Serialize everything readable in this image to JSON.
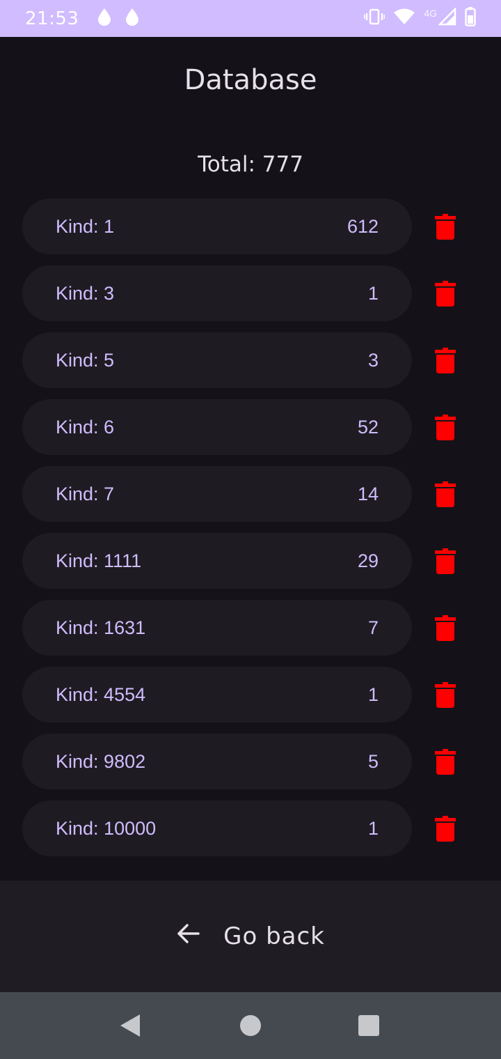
{
  "status_bar": {
    "time": "21:53",
    "network": "4G",
    "icons": [
      "drop-icon",
      "drop-icon",
      "vibrate-icon",
      "wifi-icon",
      "cell-signal-icon",
      "battery-icon"
    ]
  },
  "title": "Database",
  "total": {
    "label": "Total: ",
    "value": "777"
  },
  "kinds": [
    {
      "label": "Kind: ",
      "kind": "1",
      "count": "612"
    },
    {
      "label": "Kind: ",
      "kind": "3",
      "count": "1"
    },
    {
      "label": "Kind: ",
      "kind": "5",
      "count": "3"
    },
    {
      "label": "Kind: ",
      "kind": "6",
      "count": "52"
    },
    {
      "label": "Kind: ",
      "kind": "7",
      "count": "14"
    },
    {
      "label": "Kind: ",
      "kind": "1111",
      "count": "29"
    },
    {
      "label": "Kind: ",
      "kind": "1631",
      "count": "7"
    },
    {
      "label": "Kind: ",
      "kind": "4554",
      "count": "1"
    },
    {
      "label": "Kind: ",
      "kind": "9802",
      "count": "5"
    },
    {
      "label": "Kind: ",
      "kind": "10000",
      "count": "1"
    }
  ],
  "go_back": {
    "label": "Go back",
    "icon": "arrow-back-icon"
  },
  "colors": {
    "status_bar": "#d0bcfe",
    "background": "#141218",
    "card": "#1e1c22",
    "accent_text": "#d0bcff",
    "delete": "#ff0000",
    "bottom_bar": "#1f1d23",
    "nav_bar": "#444a50"
  }
}
